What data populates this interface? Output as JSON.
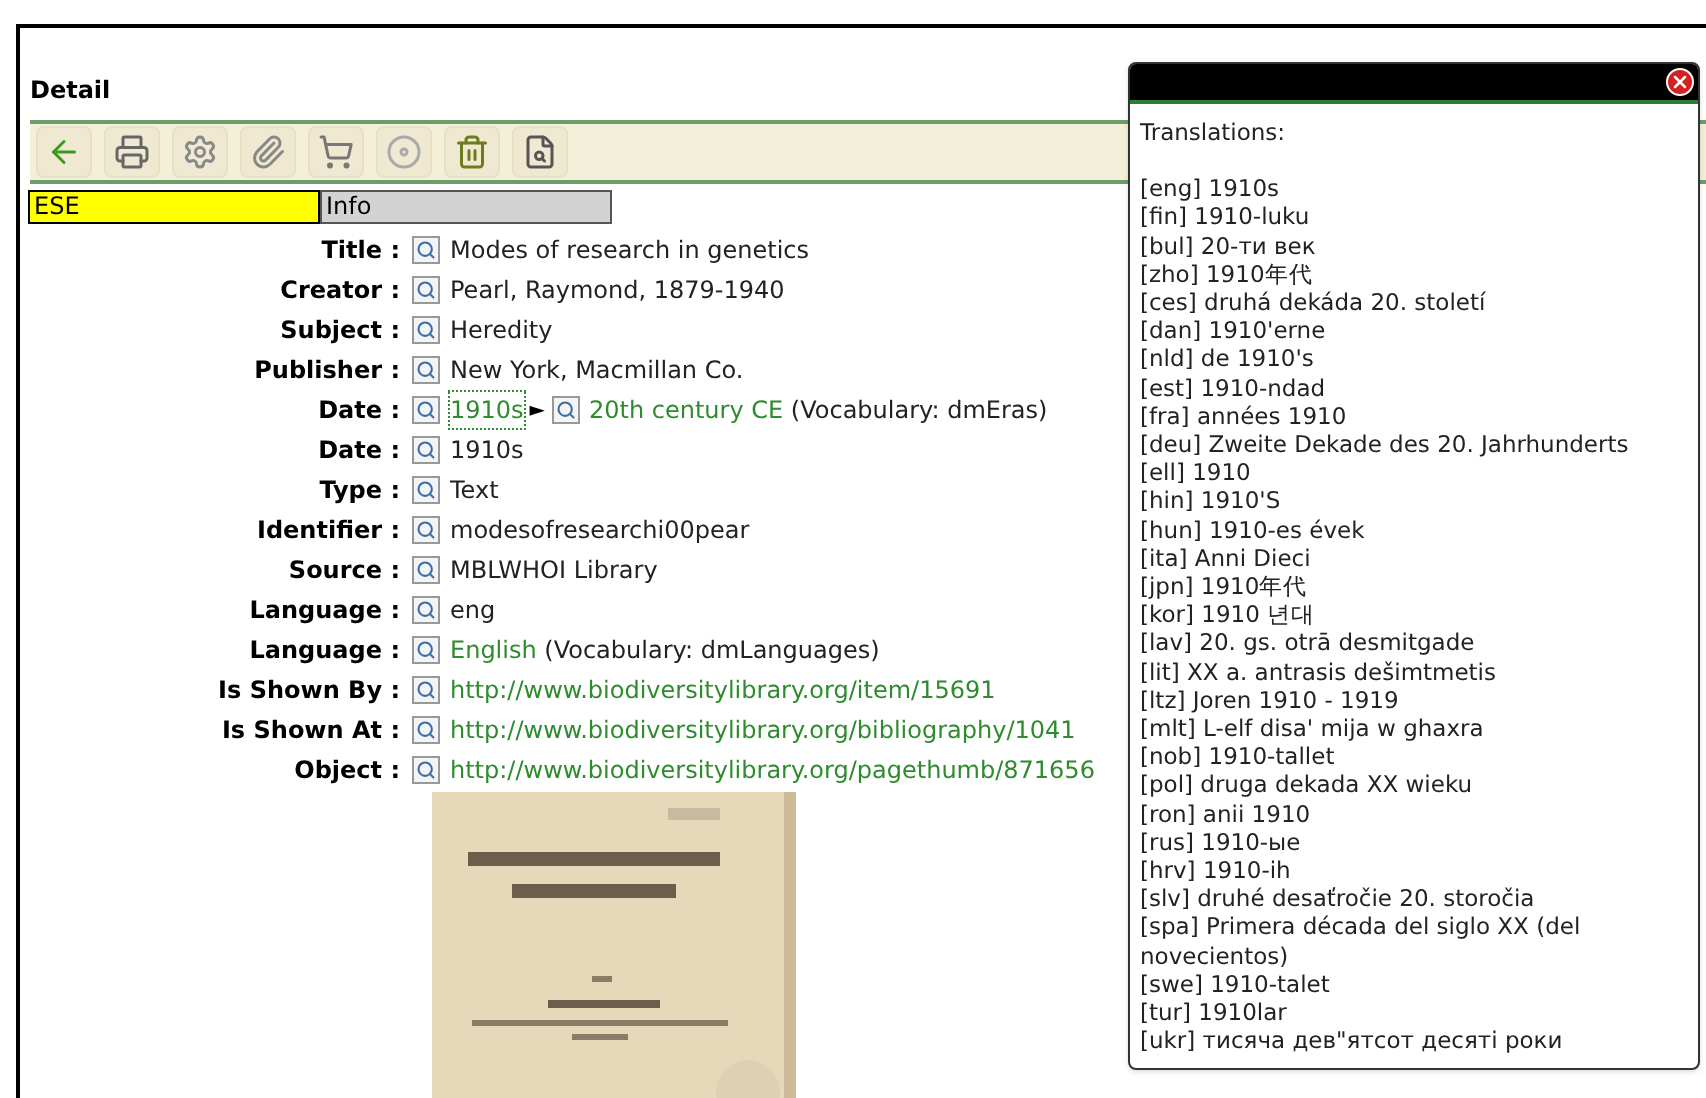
{
  "section_title": "Detail",
  "toolbar": [
    {
      "kind": "back"
    },
    {
      "kind": "print"
    },
    {
      "kind": "settings"
    },
    {
      "kind": "attach"
    },
    {
      "kind": "cart"
    },
    {
      "kind": "disc"
    },
    {
      "kind": "trash"
    },
    {
      "kind": "document"
    }
  ],
  "tabs": [
    {
      "label": "ESE",
      "selected": true
    },
    {
      "label": "Info",
      "selected": false
    }
  ],
  "fields": [
    {
      "label": "Title :",
      "parts": [
        {
          "kind": "plain",
          "text": "Modes of research in genetics"
        }
      ]
    },
    {
      "label": "Creator :",
      "parts": [
        {
          "kind": "plain",
          "text": "Pearl, Raymond, 1879-1940"
        }
      ]
    },
    {
      "label": "Subject :",
      "parts": [
        {
          "kind": "plain",
          "text": "Heredity"
        }
      ]
    },
    {
      "label": "Publisher :",
      "parts": [
        {
          "kind": "plain",
          "text": "New York, Macmillan Co."
        }
      ]
    },
    {
      "label": "Date :",
      "parts": [
        {
          "kind": "focused_link",
          "text": "1910s"
        },
        {
          "kind": "arrow",
          "text": "►"
        },
        {
          "kind": "lookup"
        },
        {
          "kind": "link",
          "text": "20th century CE"
        },
        {
          "kind": "plain",
          "text": " (Vocabulary: dmEras)"
        }
      ]
    },
    {
      "label": "Date :",
      "parts": [
        {
          "kind": "plain",
          "text": "1910s"
        }
      ]
    },
    {
      "label": "Type :",
      "parts": [
        {
          "kind": "plain",
          "text": "Text"
        }
      ]
    },
    {
      "label": "Identifier :",
      "parts": [
        {
          "kind": "plain",
          "text": "modesofresearchi00pear"
        }
      ]
    },
    {
      "label": "Source :",
      "parts": [
        {
          "kind": "plain",
          "text": "MBLWHOI Library"
        }
      ]
    },
    {
      "label": "Language :",
      "parts": [
        {
          "kind": "plain",
          "text": "eng"
        }
      ]
    },
    {
      "label": "Language :",
      "parts": [
        {
          "kind": "link",
          "text": "English"
        },
        {
          "kind": "plain",
          "text": " (Vocabulary: dmLanguages)"
        }
      ]
    },
    {
      "label": "Is Shown By :",
      "parts": [
        {
          "kind": "link",
          "text": "http://www.biodiversitylibrary.org/item/15691"
        }
      ]
    },
    {
      "label": "Is Shown At :",
      "parts": [
        {
          "kind": "link",
          "text": "http://www.biodiversitylibrary.org/bibliography/1041"
        }
      ]
    },
    {
      "label": "Object :",
      "parts": [
        {
          "kind": "link",
          "text": "http://www.biodiversitylibrary.org/pagethumb/871656"
        }
      ]
    }
  ],
  "popup": {
    "heading": "Translations:",
    "lines": [
      "[eng] 1910s",
      "[fin] 1910-luku",
      "[bul] 20-ти век",
      "[zho] 1910年代",
      "[ces] druhá dekáda 20. století",
      "[dan] 1910'erne",
      "[nld] de 1910's",
      "[est] 1910-ndad",
      "[fra] années 1910",
      "[deu] Zweite Dekade des 20. Jahrhunderts",
      "[ell] 1910",
      "[hin] 1910'S",
      "[hun] 1910-es évek",
      "[ita] Anni Dieci",
      "[jpn] 1910年代",
      "[kor] 1910 년대",
      "[lav] 20. gs. otrā desmitgade",
      "[lit] XX a. antrasis dešimtmetis",
      "[ltz] Joren 1910 - 1919",
      "[mlt] L-elf disa' mija w ghaxra",
      "[nob] 1910-tallet",
      "[pol] druga dekada XX wieku",
      "[ron] anii 1910",
      "[rus] 1910-ые",
      "[hrv] 1910-ih",
      "[slv] druhé desaťročie 20. storočia",
      "[spa] Primera década del siglo XX (del novecientos)",
      "[swe] 1910-talet",
      "[tur] 1910lar",
      "[ukr] тисяча дев\"ятсот десяті роки"
    ]
  }
}
